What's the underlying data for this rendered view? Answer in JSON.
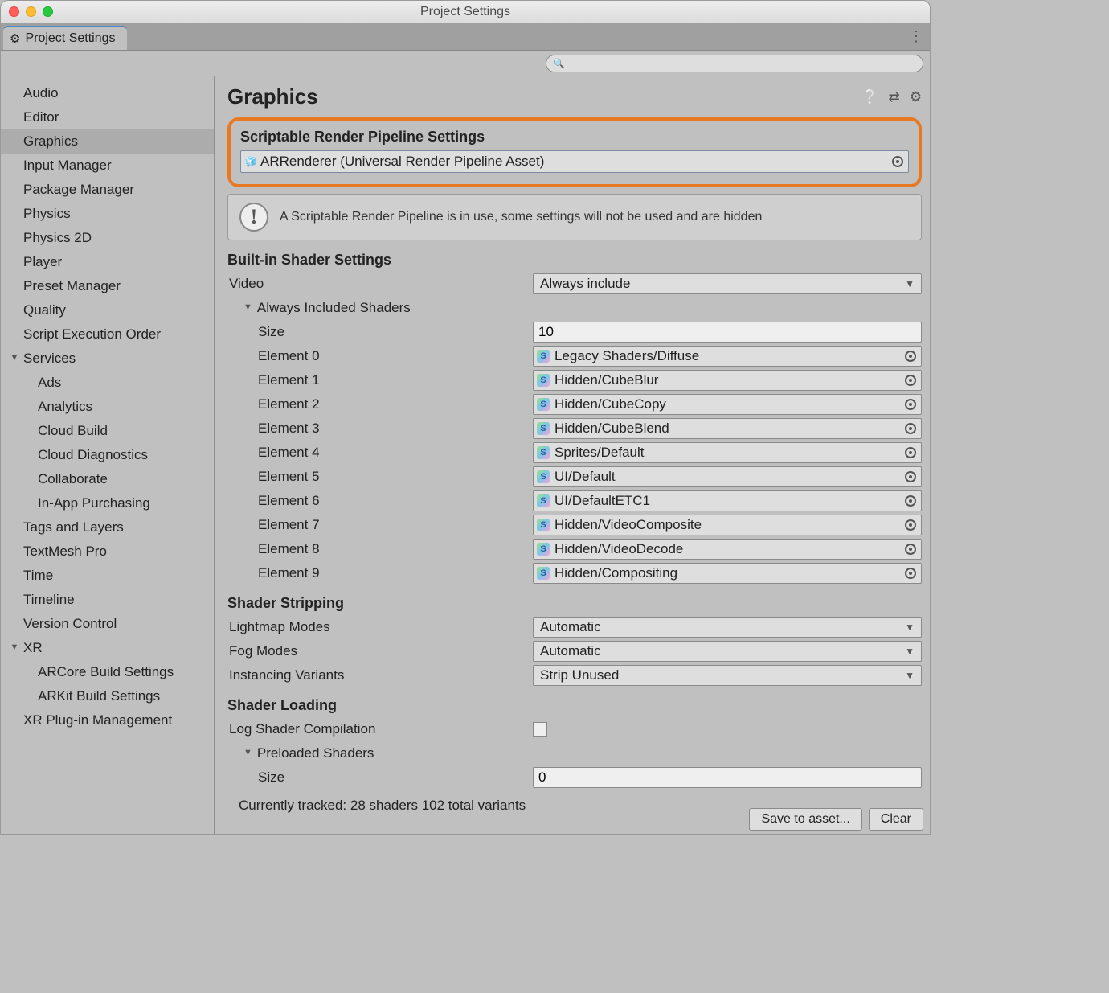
{
  "window": {
    "title": "Project Settings",
    "tabName": "Project Settings"
  },
  "search": {
    "placeholder": ""
  },
  "sidebar": {
    "items": [
      {
        "label": "Audio"
      },
      {
        "label": "Editor"
      },
      {
        "label": "Graphics",
        "selected": true
      },
      {
        "label": "Input Manager"
      },
      {
        "label": "Package Manager"
      },
      {
        "label": "Physics"
      },
      {
        "label": "Physics 2D"
      },
      {
        "label": "Player"
      },
      {
        "label": "Preset Manager"
      },
      {
        "label": "Quality"
      },
      {
        "label": "Script Execution Order"
      },
      {
        "label": "Services",
        "expandable": true,
        "children": [
          {
            "label": "Ads"
          },
          {
            "label": "Analytics"
          },
          {
            "label": "Cloud Build"
          },
          {
            "label": "Cloud Diagnostics"
          },
          {
            "label": "Collaborate"
          },
          {
            "label": "In-App Purchasing"
          }
        ]
      },
      {
        "label": "Tags and Layers"
      },
      {
        "label": "TextMesh Pro"
      },
      {
        "label": "Time"
      },
      {
        "label": "Timeline"
      },
      {
        "label": "Version Control"
      },
      {
        "label": "XR",
        "expandable": true,
        "children": [
          {
            "label": "ARCore Build Settings"
          },
          {
            "label": "ARKit Build Settings"
          }
        ]
      },
      {
        "label": "XR Plug-in Management"
      }
    ]
  },
  "page": {
    "title": "Graphics",
    "srp": {
      "heading": "Scriptable Render Pipeline Settings",
      "asset": "ARRenderer (Universal Render Pipeline Asset)"
    },
    "info": "A Scriptable Render Pipeline is in use, some settings will not be used and are hidden",
    "builtIn": {
      "heading": "Built-in Shader Settings",
      "videoLabel": "Video",
      "videoValue": "Always include",
      "includedLabel": "Always Included Shaders",
      "sizeLabel": "Size",
      "sizeValue": "10",
      "elements": [
        {
          "label": "Element 0",
          "value": "Legacy Shaders/Diffuse"
        },
        {
          "label": "Element 1",
          "value": "Hidden/CubeBlur"
        },
        {
          "label": "Element 2",
          "value": "Hidden/CubeCopy"
        },
        {
          "label": "Element 3",
          "value": "Hidden/CubeBlend"
        },
        {
          "label": "Element 4",
          "value": "Sprites/Default"
        },
        {
          "label": "Element 5",
          "value": "UI/Default"
        },
        {
          "label": "Element 6",
          "value": "UI/DefaultETC1"
        },
        {
          "label": "Element 7",
          "value": "Hidden/VideoComposite"
        },
        {
          "label": "Element 8",
          "value": "Hidden/VideoDecode"
        },
        {
          "label": "Element 9",
          "value": "Hidden/Compositing"
        }
      ]
    },
    "stripping": {
      "heading": "Shader Stripping",
      "lightmapLabel": "Lightmap Modes",
      "lightmapValue": "Automatic",
      "fogLabel": "Fog Modes",
      "fogValue": "Automatic",
      "instLabel": "Instancing Variants",
      "instValue": "Strip Unused"
    },
    "loading": {
      "heading": "Shader Loading",
      "logLabel": "Log Shader Compilation",
      "preloadedLabel": "Preloaded Shaders",
      "sizeLabel": "Size",
      "sizeValue": "0",
      "tracked": "Currently tracked: 28 shaders 102 total variants"
    },
    "footer": {
      "save": "Save to asset...",
      "clear": "Clear"
    }
  }
}
